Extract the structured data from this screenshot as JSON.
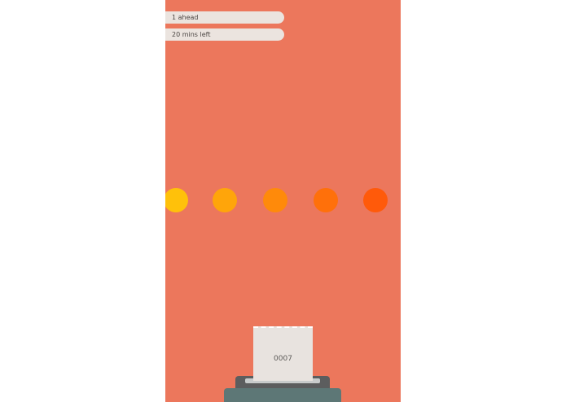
{
  "status": {
    "ahead_text": "1 ahead",
    "time_text": "20 mins left"
  },
  "progress_dots": [
    {
      "color": "#ffc10a"
    },
    {
      "color": "#ffa50a"
    },
    {
      "color": "#ff8a0a"
    },
    {
      "color": "#ff700a"
    },
    {
      "color": "#ff5a0a"
    }
  ],
  "ticket": {
    "number": "0007"
  },
  "colors": {
    "background": "#ec775c",
    "pill": "#ebe4df",
    "ticket": "#e8e3df",
    "dispenser_tray": "#5c5d5e",
    "dispenser_base": "#5d7776"
  }
}
